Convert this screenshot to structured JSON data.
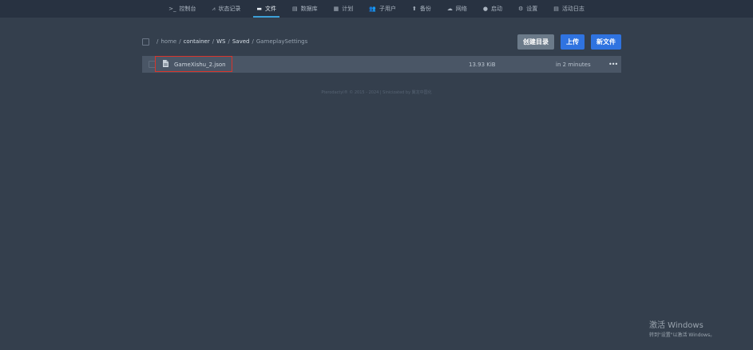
{
  "nav": {
    "items": [
      {
        "icon": ">_",
        "label": "控制台",
        "active": false
      },
      {
        "icon": "⩘",
        "label": "状态记录",
        "active": false
      },
      {
        "icon": "▬",
        "label": "文件",
        "active": true
      },
      {
        "icon": "▤",
        "label": "数据库",
        "active": false
      },
      {
        "icon": "▦",
        "label": "计划",
        "active": false
      },
      {
        "icon": "👥",
        "label": "子用户",
        "active": false
      },
      {
        "icon": "⬆",
        "label": "备份",
        "active": false
      },
      {
        "icon": "☁",
        "label": "网络",
        "active": false
      },
      {
        "icon": "●",
        "label": "启动",
        "active": false
      },
      {
        "icon": "⚙",
        "label": "设置",
        "active": false
      },
      {
        "icon": "▤",
        "label": "活动日志",
        "active": false
      }
    ]
  },
  "breadcrumb": {
    "sep": "/",
    "parts": [
      "home",
      "container",
      "WS",
      "Saved",
      "GameplaySettings"
    ]
  },
  "buttons": {
    "create_dir": "创建目录",
    "upload": "上传",
    "new_file": "新文件"
  },
  "files": [
    {
      "name": "GameXishu_2.json",
      "size": "13.93 KiB",
      "modified": "in 2 minutes",
      "more": "•••"
    }
  ],
  "footer": "Pterodactyl® © 2015 - 2024 | Sinicizated by 翼龙中国化",
  "watermark": {
    "title": "激活 Windows",
    "subtitle": "转到\"设置\"以激活 Windows。"
  },
  "colors": {
    "background": "#343f4d",
    "nav_bg": "#283241",
    "accent": "#3ca0d8",
    "primary_button": "#2f73e0",
    "secondary_button": "#6b7a89",
    "highlight": "#d9352b"
  }
}
